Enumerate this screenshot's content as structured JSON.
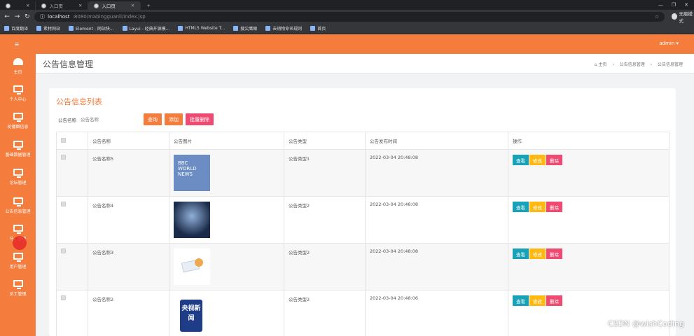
{
  "browser": {
    "tabs": [
      {
        "label": ""
      },
      {
        "label": "入口页"
      },
      {
        "label": "入口页"
      }
    ],
    "url_host": "localhost",
    "url_path": ":8080/mabingguanli/index.jsp",
    "incognito_label": "无痕模式",
    "bookmarks": [
      "百度翻译",
      "素材网站",
      "Element - 网站快...",
      "Layui - 经典开源模...",
      "HTML5 Website T...",
      "搜尖鹰眼",
      "去销物命名规则",
      "首页"
    ]
  },
  "app": {
    "user": "admin ▾",
    "sidebar": [
      {
        "label": "主页",
        "icon": "dashboard-icon"
      },
      {
        "label": "个人中心",
        "icon": "monitor-icon"
      },
      {
        "label": "轮播图信息",
        "icon": "monitor-icon"
      },
      {
        "label": "基础数据管理",
        "icon": "monitor-icon"
      },
      {
        "label": "论坛管理",
        "icon": "monitor-icon"
      },
      {
        "label": "公告信息管理",
        "icon": "monitor-icon"
      },
      {
        "label": "马…管理",
        "icon": "monitor-icon"
      },
      {
        "label": "用户管理",
        "icon": "monitor-icon"
      },
      {
        "label": "员工管理",
        "icon": "monitor-icon"
      }
    ],
    "page_title": "公告信息管理",
    "breadcrumb": [
      "⌂ 主页",
      "›",
      "公告信息管理",
      "›",
      "公告信息管理"
    ],
    "card_title": "公告信息列表",
    "search": {
      "label": "公告名称",
      "placeholder": "公告名称"
    },
    "buttons": {
      "query": "查询",
      "add": "添加",
      "batch_delete": "批量删除"
    },
    "table": {
      "headers": [
        "",
        "公告名称",
        "公告图片",
        "公告类型",
        "公告发布时间",
        "操作"
      ],
      "rows": [
        {
          "name": "公告名称5",
          "image": "BBC WORLD NEWS",
          "type": "公告类型1",
          "time": "2022-03-04 20:48:08"
        },
        {
          "name": "公告名称4",
          "image": "stage",
          "type": "公告类型2",
          "time": "2022-03-04 20:48:08"
        },
        {
          "name": "公告名称3",
          "image": "card",
          "type": "公告类型2",
          "time": "2022-03-04 20:48:08"
        },
        {
          "name": "公告名称2",
          "image": "央视新闻",
          "type": "公告类型2",
          "time": "2022-03-04 20:48:06"
        }
      ],
      "ops": {
        "view": "查看",
        "edit": "修改",
        "delete": "删除"
      }
    },
    "watermark": "CSDN @wishCoding"
  }
}
